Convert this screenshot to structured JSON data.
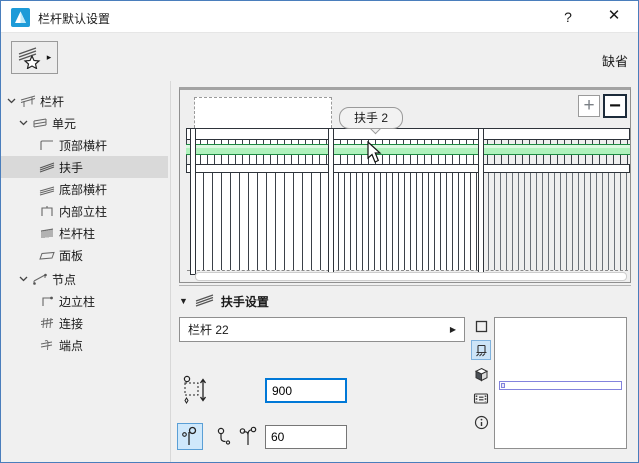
{
  "window": {
    "title": "栏杆默认设置",
    "help_label": "?",
    "close_label": "✕"
  },
  "toolbar": {
    "favorites_arrow": "▸",
    "default_label": "缺省"
  },
  "tree": {
    "items": [
      {
        "label": "栏杆"
      },
      {
        "label": "单元"
      },
      {
        "label": "顶部横杆"
      },
      {
        "label": "扶手"
      },
      {
        "label": "底部横杆"
      },
      {
        "label": "内部立柱"
      },
      {
        "label": "栏杆柱"
      },
      {
        "label": "面板"
      },
      {
        "label": "节点"
      },
      {
        "label": "边立柱"
      },
      {
        "label": "连接"
      },
      {
        "label": "端点"
      }
    ]
  },
  "preview": {
    "tooltip_label": "扶手 2",
    "zoom_in_label": "+",
    "zoom_out_label": "−"
  },
  "section": {
    "collapse_glyph": "▼",
    "title": "扶手设置"
  },
  "settings": {
    "rail_dropdown_value": "栏杆 22",
    "dropdown_arrow": "▶",
    "height_value": "900",
    "offset_value": "60"
  },
  "colors": {
    "handrail_highlight_green": "#aff2bc",
    "focus_border_blue": "#0078d7",
    "selected_toggle_blue": "#cfe8fb",
    "profile_outline_violet": "#8383dd",
    "window_border_blue": "#4a7ebc"
  }
}
